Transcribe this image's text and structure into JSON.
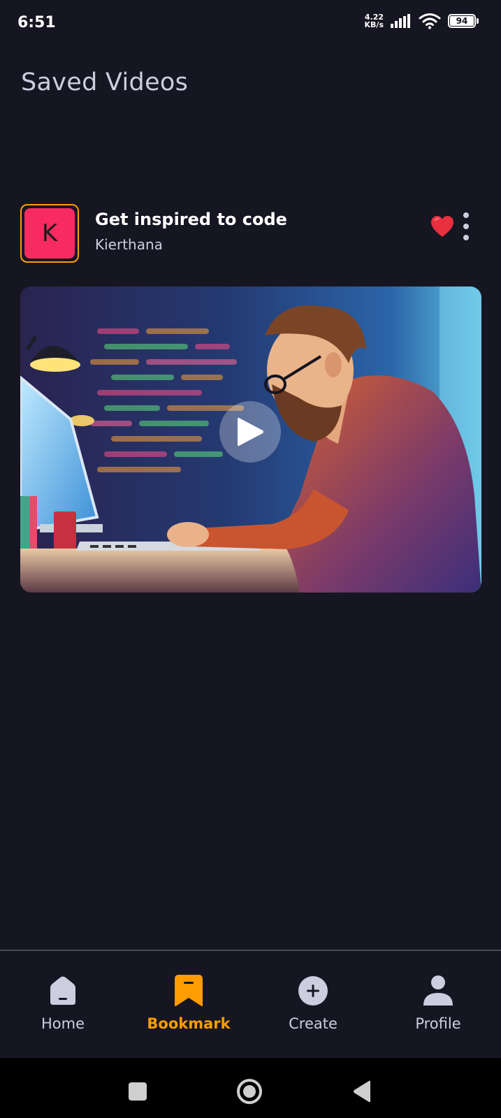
{
  "status_bar": {
    "time": "6:51",
    "net_speed_value": "4.22",
    "net_speed_unit": "KB/s",
    "battery": "94"
  },
  "header": {
    "title": "Saved Videos"
  },
  "video": {
    "avatar_letter": "K",
    "title": "Get inspired to code",
    "creator": "Kierthana",
    "liked": true,
    "icons": [
      "heart-icon",
      "more-vertical-icon",
      "play-icon"
    ]
  },
  "tabs": [
    {
      "label": "Home",
      "icon": "home-icon",
      "active": false
    },
    {
      "label": "Bookmark",
      "icon": "bookmark-icon",
      "active": true
    },
    {
      "label": "Create",
      "icon": "plus-circle-icon",
      "active": false
    },
    {
      "label": "Profile",
      "icon": "profile-icon",
      "active": false
    }
  ],
  "colors": {
    "background": "#161622",
    "accent": "#FF9C01",
    "avatar": "#F72B61",
    "heart": "#E8303F",
    "muted_text": "#CDCDE0"
  }
}
